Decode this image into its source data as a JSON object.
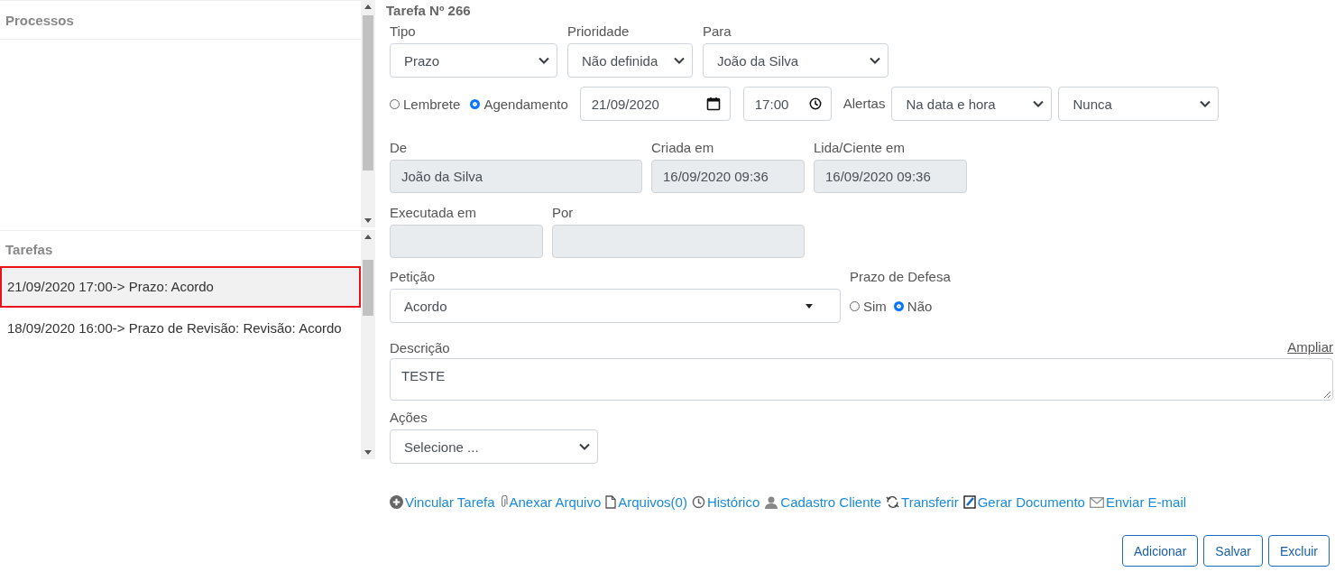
{
  "sidebar": {
    "processes": {
      "title": "Processos"
    },
    "tasks": {
      "title": "Tarefas",
      "items": [
        {
          "label": "21/09/2020 17:00-> Prazo: Acordo",
          "selected": true
        },
        {
          "label": "18/09/2020 16:00-> Prazo de Revisão: Revisão: Acordo",
          "selected": false
        }
      ]
    }
  },
  "form": {
    "title": "Tarefa Nº 266",
    "tipo": {
      "label": "Tipo",
      "value": "Prazo"
    },
    "prioridade": {
      "label": "Prioridade",
      "value": "Não definida"
    },
    "para": {
      "label": "Para",
      "value": "João da Silva"
    },
    "mode_options": [
      {
        "label": "Lembrete",
        "selected": false
      },
      {
        "label": "Agendamento",
        "selected": true
      }
    ],
    "date": {
      "value": "21/09/2020"
    },
    "time": {
      "value": "17:00"
    },
    "alerts": {
      "label": "Alertas",
      "when": "Na data e hora",
      "repeat": "Nunca"
    },
    "de": {
      "label": "De",
      "value": "João da Silva"
    },
    "criada": {
      "label": "Criada em",
      "value": "16/09/2020 09:36"
    },
    "lida": {
      "label": "Lida/Ciente em",
      "value": "16/09/2020 09:36"
    },
    "executada": {
      "label": "Executada em"
    },
    "por": {
      "label": "Por"
    },
    "peticao": {
      "label": "Petição",
      "value": "Acordo"
    },
    "prazo_defesa": {
      "label": "Prazo de Defesa",
      "options": [
        {
          "label": "Sim",
          "selected": false
        },
        {
          "label": "Não",
          "selected": true
        }
      ]
    },
    "descricao": {
      "label": "Descrição",
      "expand_link": "Ampliar",
      "value": "TESTE"
    },
    "acoes": {
      "label": "Ações",
      "value": "Selecione ..."
    },
    "links": [
      "Vincular Tarefa",
      "Anexar Arquivo",
      "Arquivos(0)",
      "Histórico",
      "Cadastro Cliente",
      "Transferir",
      "Gerar Documento",
      "Enviar E-mail"
    ],
    "buttons": [
      "Adicionar",
      "Salvar",
      "Excluir"
    ]
  }
}
